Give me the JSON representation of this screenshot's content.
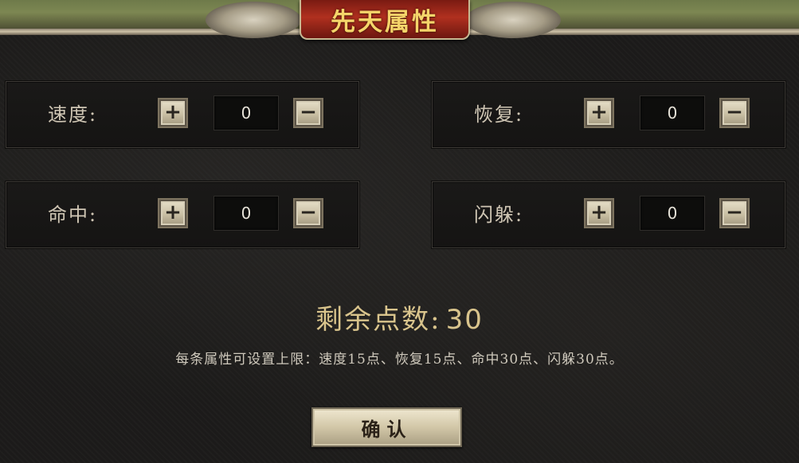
{
  "title": "先天属性",
  "attributes": [
    {
      "label": "速度:",
      "value": "0"
    },
    {
      "label": "恢复:",
      "value": "0"
    },
    {
      "label": "命中:",
      "value": "0"
    },
    {
      "label": "闪躲:",
      "value": "0"
    }
  ],
  "controls": {
    "plus_symbol": "+",
    "minus_symbol": "−"
  },
  "remaining": {
    "label": "剩余点数:",
    "value": "30"
  },
  "note": "每条属性可设置上限：速度15点、恢复15点、命中30点、闪躲30点。",
  "confirm_label": "确认",
  "colors": {
    "title_text": "#f5d56a",
    "title_plate": "#b0301f",
    "remaining_text": "#d9c48c",
    "background": "#1c1b1a"
  }
}
